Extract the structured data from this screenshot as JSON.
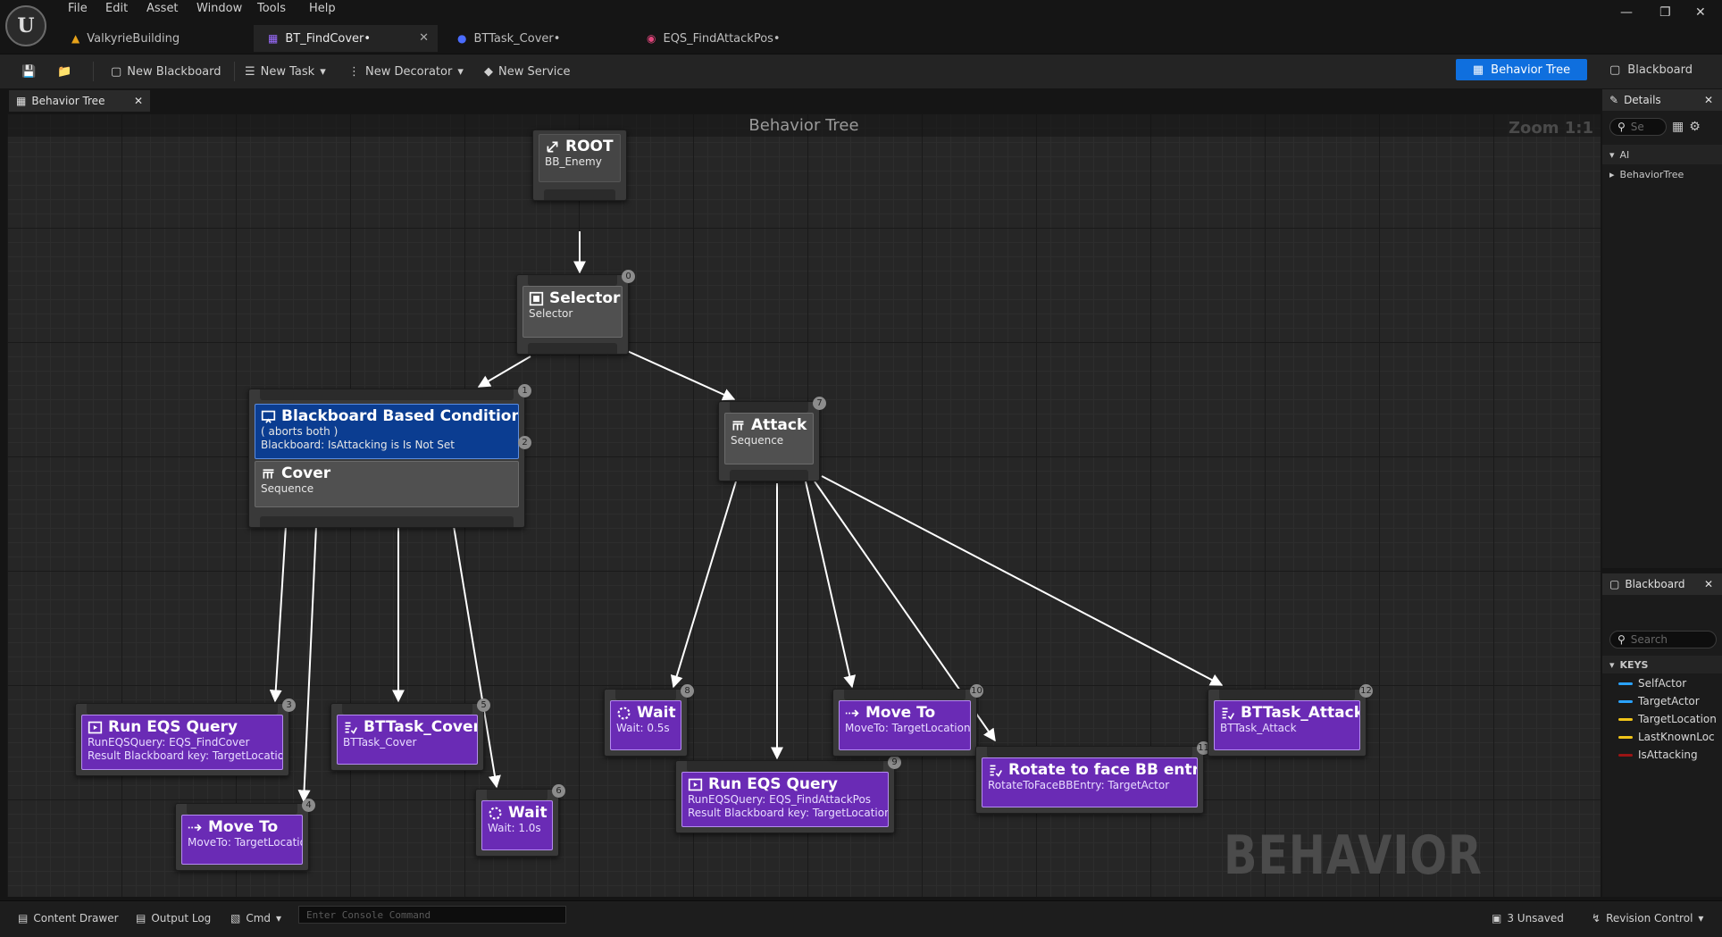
{
  "menu": [
    "File",
    "Edit",
    "Asset",
    "Window",
    "Tools",
    "Help"
  ],
  "doc_tabs": [
    {
      "label": "ValkyrieBuilding"
    },
    {
      "label": "BT_FindCover•"
    },
    {
      "label": "BTTask_Cover•"
    },
    {
      "label": "EQS_FindAttackPos•"
    }
  ],
  "toolbar": {
    "new_blackboard": "New Blackboard",
    "new_task": "New Task",
    "new_decorator": "New Decorator",
    "new_service": "New Service",
    "mode_behavior_tree": "Behavior Tree",
    "mode_blackboard": "Blackboard"
  },
  "graph": {
    "panel_tab": "Behavior Tree",
    "title": "Behavior Tree",
    "zoom": "Zoom 1:1",
    "watermark": "BEHAVIOR TREE"
  },
  "nodes": {
    "root": {
      "title": "ROOT",
      "sub": "BB_Enemy"
    },
    "selector": {
      "title": "Selector",
      "sub": "Selector",
      "index": "0"
    },
    "bb_condition": {
      "title": "Blackboard Based Condition",
      "line1": "( aborts both )",
      "line2": "Blackboard: IsAttacking is Is Not Set",
      "index": "1"
    },
    "cover": {
      "title": "Cover",
      "sub": "Sequence",
      "index": "2"
    },
    "run_eqs_1": {
      "title": "Run EQS Query",
      "line1": "RunEQSQuery: EQS_FindCover",
      "line2": "Result Blackboard key: TargetLocation",
      "index": "3"
    },
    "move_to_1": {
      "title": "Move To",
      "sub": "MoveTo: TargetLocation",
      "index": "4"
    },
    "bttask_cover": {
      "title": "BTTask_Cover",
      "sub": "BTTask_Cover",
      "index": "5"
    },
    "wait_1": {
      "title": "Wait",
      "sub": "Wait: 1.0s",
      "index": "6"
    },
    "attack": {
      "title": "Attack",
      "sub": "Sequence",
      "index": "7"
    },
    "wait_2": {
      "title": "Wait",
      "sub": "Wait: 0.5s",
      "index": "8"
    },
    "run_eqs_2": {
      "title": "Run EQS Query",
      "line1": "RunEQSQuery: EQS_FindAttackPos",
      "line2": "Result Blackboard key: TargetLocation",
      "index": "9"
    },
    "move_to_2": {
      "title": "Move To",
      "sub": "MoveTo: TargetLocation",
      "index": "10"
    },
    "rotate": {
      "title": "Rotate to face BB entry",
      "sub": "RotateToFaceBBEntry: TargetActor",
      "index": "11"
    },
    "bttask_attack": {
      "title": "BTTask_Attack",
      "sub": "BTTask_Attack",
      "index": "12"
    }
  },
  "details": {
    "tab": "Details",
    "search_placeholder": "Se",
    "categories": [
      "AI",
      "BehaviorTree"
    ]
  },
  "blackboard": {
    "tab": "Blackboard",
    "search_placeholder": "Search",
    "keys_header": "KEYS",
    "keys": [
      {
        "name": "SelfActor",
        "color": "#2aa3ff"
      },
      {
        "name": "TargetActor",
        "color": "#2aa3ff"
      },
      {
        "name": "TargetLocation",
        "color": "#f0c419"
      },
      {
        "name": "LastKnownLoc",
        "color": "#f0c419"
      },
      {
        "name": "IsAttacking",
        "color": "#9b1414"
      }
    ]
  },
  "statusbar": {
    "content_drawer": "Content Drawer",
    "output_log": "Output Log",
    "cmd": "Cmd",
    "console_placeholder": "Enter Console Command",
    "unsaved": "3 Unsaved",
    "revision_control": "Revision Control"
  },
  "colors": {
    "accent": "#0f6fde",
    "task_purple": "#6a2bb5",
    "decorator_blue": "#0b3d91"
  }
}
